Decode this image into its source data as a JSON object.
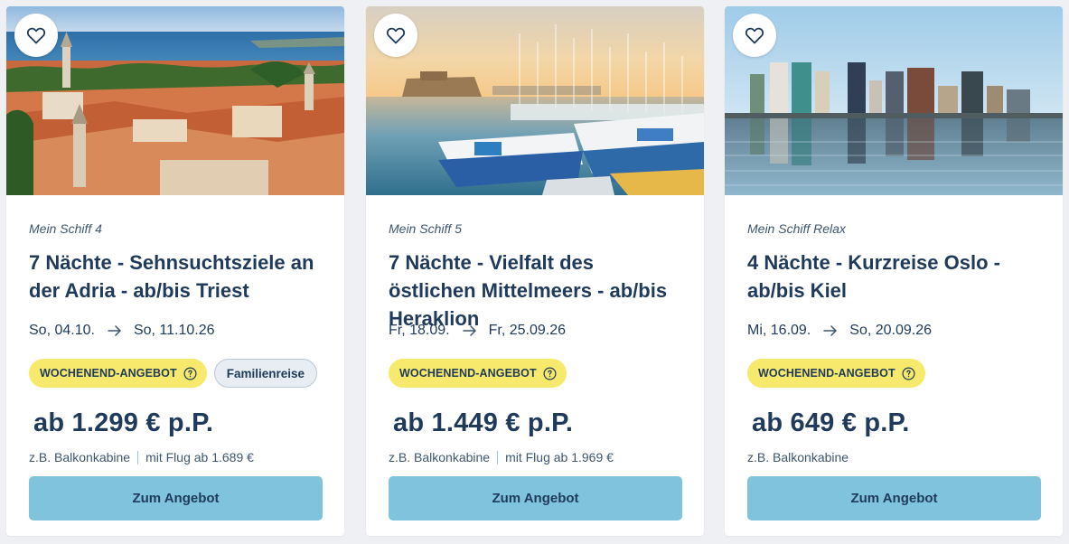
{
  "cards": [
    {
      "image_icon": "adriatic-old-town-photo",
      "ship": "Mein Schiff 4",
      "title": "7 Nächte - Sehnsuchtsziele an der Adria - ab/bis Triest",
      "date_from": "So, 04.10.",
      "date_to": "So, 11.10.26",
      "offer_badge": "WOCHENEND-ANGEBOT",
      "tag": "Familienreise",
      "price": "ab 1.299 € p.P.",
      "cabin": "z.B. Balkonkabine",
      "flight": "mit Flug ab 1.689 €",
      "cta": "Zum Angebot"
    },
    {
      "image_icon": "heraklion-harbor-photo",
      "ship": "Mein Schiff 5",
      "title": "7 Nächte - Vielfalt des östlichen Mittelmeers - ab/bis Heraklion",
      "date_from": "Fr, 18.09.",
      "date_to": "Fr, 25.09.26",
      "offer_badge": "WOCHENEND-ANGEBOT",
      "tag": "",
      "price": "ab 1.449 € p.P.",
      "cabin": "z.B. Balkonkabine",
      "flight": "mit Flug ab 1.969 €",
      "cta": "Zum Angebot"
    },
    {
      "image_icon": "oslo-skyline-photo",
      "ship": "Mein Schiff Relax",
      "title": "4 Nächte - Kurzreise Oslo - ab/bis Kiel",
      "date_from": "Mi, 16.09.",
      "date_to": "So, 20.09.26",
      "offer_badge": "WOCHENEND-ANGEBOT",
      "tag": "",
      "price": "ab 649 € p.P.",
      "cabin": "z.B. Balkonkabine",
      "flight": "",
      "cta": "Zum Angebot"
    }
  ],
  "colors": {
    "primary_text": "#1f3a5a",
    "offer_badge_bg": "#f7e96b",
    "cta_bg": "#7fc3dc",
    "tag_bg": "#e7edf3",
    "page_bg": "#eef0f3"
  },
  "icons": {
    "favorite": "heart-outline-icon",
    "arrow": "arrow-right-icon",
    "info": "info-circle-icon"
  }
}
